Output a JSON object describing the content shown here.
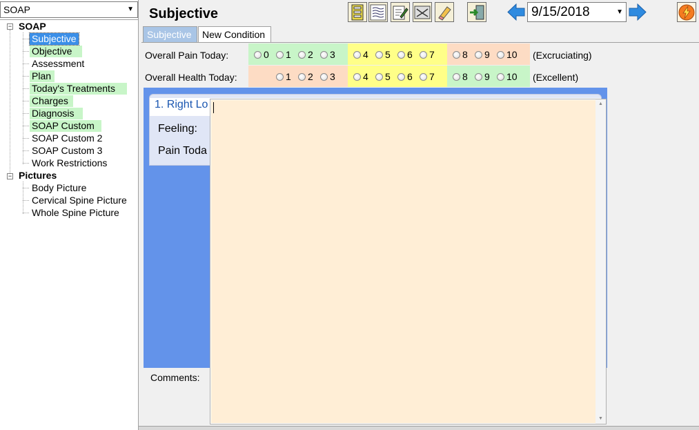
{
  "module_select": {
    "value": "SOAP"
  },
  "tree": {
    "groups": [
      {
        "label": "SOAP",
        "items": [
          {
            "label": "Subjective",
            "state": "selected"
          },
          {
            "label": "Objective",
            "state": "green"
          },
          {
            "label": "Assessment",
            "state": "plain"
          },
          {
            "label": "Plan",
            "state": "green"
          },
          {
            "label": "Today's Treatments",
            "state": "green"
          },
          {
            "label": "Charges",
            "state": "green"
          },
          {
            "label": "Diagnosis",
            "state": "green"
          },
          {
            "label": "SOAP Custom",
            "state": "green"
          },
          {
            "label": "SOAP Custom 2",
            "state": "plain"
          },
          {
            "label": "SOAP Custom 3",
            "state": "plain"
          },
          {
            "label": "Work Restrictions",
            "state": "plain"
          }
        ]
      },
      {
        "label": "Pictures",
        "items": [
          {
            "label": "Body Picture",
            "state": "plain"
          },
          {
            "label": "Cervical Spine Picture",
            "state": "plain"
          },
          {
            "label": "Whole Spine Picture",
            "state": "plain"
          }
        ]
      }
    ]
  },
  "header": {
    "title": "Subjective"
  },
  "toolbar": {
    "buttons": [
      "form-icon",
      "lines-icon",
      "edit-note-icon",
      "picture-icon",
      "eraser-icon",
      "exit-door-icon"
    ],
    "date": "9/15/2018",
    "lightning": "lightning-icon"
  },
  "tabs": [
    {
      "label": "Subjective",
      "active": true
    },
    {
      "label": "New Condition",
      "active": false
    }
  ],
  "ratings": {
    "pain": {
      "label": "Overall Pain Today:",
      "scale_note": "(Excruciating)",
      "bands": [
        {
          "color": "#c8f5c8",
          "options": [
            "0",
            "1",
            "2",
            "3"
          ]
        },
        {
          "color": "#ffff88",
          "options": [
            "4",
            "5",
            "6",
            "7"
          ]
        },
        {
          "color": "#fddcc4",
          "options": [
            "8",
            "9",
            "10"
          ]
        }
      ]
    },
    "health": {
      "label": "Overall Health Today:",
      "scale_note": "(Excellent)",
      "bands": [
        {
          "color": "#fddcc4",
          "options": [
            "1",
            "2",
            "3"
          ]
        },
        {
          "color": "#ffff88",
          "options": [
            "4",
            "5",
            "6",
            "7"
          ]
        },
        {
          "color": "#c8f5c8",
          "options": [
            "8",
            "9",
            "10"
          ]
        }
      ]
    }
  },
  "condition": {
    "title": "1. Right Lo",
    "feeling_label": "Feeling:",
    "pain_today_label": "Pain Toda"
  },
  "comments": {
    "label": "Comments:",
    "value": ""
  },
  "colors": {
    "selected_item": "#3b8fe8",
    "completed_item": "#c8f5c8",
    "condition_panel": "#6393ea",
    "editor_bg": "#ffeed6"
  }
}
